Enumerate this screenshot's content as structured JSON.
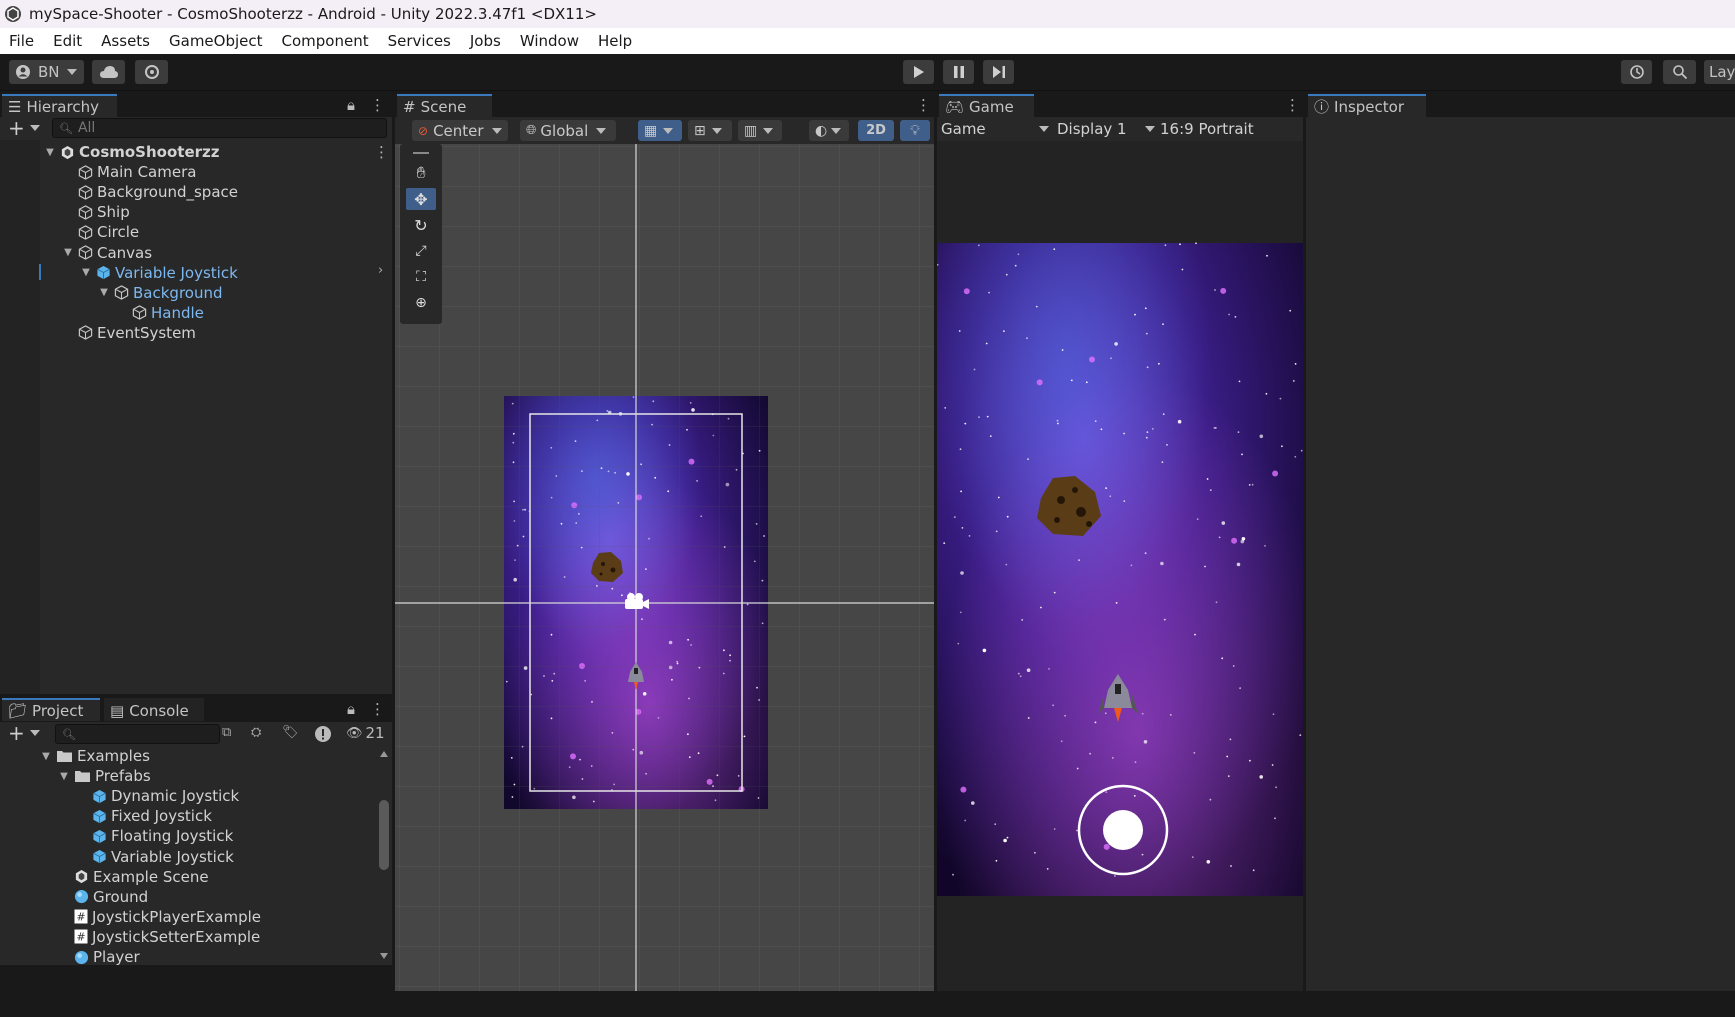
{
  "window": {
    "title": "mySpace-Shooter - CosmoShooterzz - Android - Unity 2022.3.47f1 <DX11>"
  },
  "menu": [
    "File",
    "Edit",
    "Assets",
    "GameObject",
    "Component",
    "Services",
    "Jobs",
    "Window",
    "Help"
  ],
  "toolbar": {
    "account": "BN",
    "right_label": "Lay"
  },
  "hierarchy": {
    "tab": "Hierarchy",
    "search_placeholder": "All",
    "items": [
      {
        "label": "CosmoShooterzz",
        "depth": 0,
        "kind": "scene",
        "expanded": true,
        "bold": true
      },
      {
        "label": "Main Camera",
        "depth": 1,
        "kind": "go"
      },
      {
        "label": "Background_space",
        "depth": 1,
        "kind": "go"
      },
      {
        "label": "Ship",
        "depth": 1,
        "kind": "go"
      },
      {
        "label": "Circle",
        "depth": 1,
        "kind": "go"
      },
      {
        "label": "Canvas",
        "depth": 1,
        "kind": "go",
        "expanded": true
      },
      {
        "label": "Variable Joystick",
        "depth": 2,
        "kind": "prefab",
        "expanded": true,
        "blue": true,
        "selected": true
      },
      {
        "label": "Background",
        "depth": 3,
        "kind": "go",
        "expanded": true,
        "blue": true
      },
      {
        "label": "Handle",
        "depth": 4,
        "kind": "go",
        "blue": true
      },
      {
        "label": "EventSystem",
        "depth": 1,
        "kind": "go"
      }
    ]
  },
  "project": {
    "tabs": [
      "Project",
      "Console"
    ],
    "hidden_count": "21",
    "items": [
      {
        "label": "Examples",
        "depth": 0,
        "kind": "folder",
        "expanded": true
      },
      {
        "label": "Prefabs",
        "depth": 1,
        "kind": "folder",
        "expanded": true
      },
      {
        "label": "Dynamic Joystick",
        "depth": 2,
        "kind": "prefab"
      },
      {
        "label": "Fixed Joystick",
        "depth": 2,
        "kind": "prefab"
      },
      {
        "label": "Floating Joystick",
        "depth": 2,
        "kind": "prefab"
      },
      {
        "label": "Variable Joystick",
        "depth": 2,
        "kind": "prefab"
      },
      {
        "label": "Example Scene",
        "depth": 1,
        "kind": "scene"
      },
      {
        "label": "Ground",
        "depth": 1,
        "kind": "material"
      },
      {
        "label": "JoystickPlayerExample",
        "depth": 1,
        "kind": "script"
      },
      {
        "label": "JoystickSetterExample",
        "depth": 1,
        "kind": "script"
      },
      {
        "label": "Player",
        "depth": 1,
        "kind": "material"
      }
    ]
  },
  "scene": {
    "tab": "Scene",
    "pivot": "Center",
    "space": "Global",
    "mode_2d": "2D"
  },
  "game": {
    "tab": "Game",
    "mode": "Game",
    "display": "Display 1",
    "aspect": "16:9 Portrait"
  },
  "inspector": {
    "tab": "Inspector"
  },
  "colors": {
    "accent": "#3a79bb",
    "selection_blue": "#7db8f0",
    "panel": "#282828"
  }
}
